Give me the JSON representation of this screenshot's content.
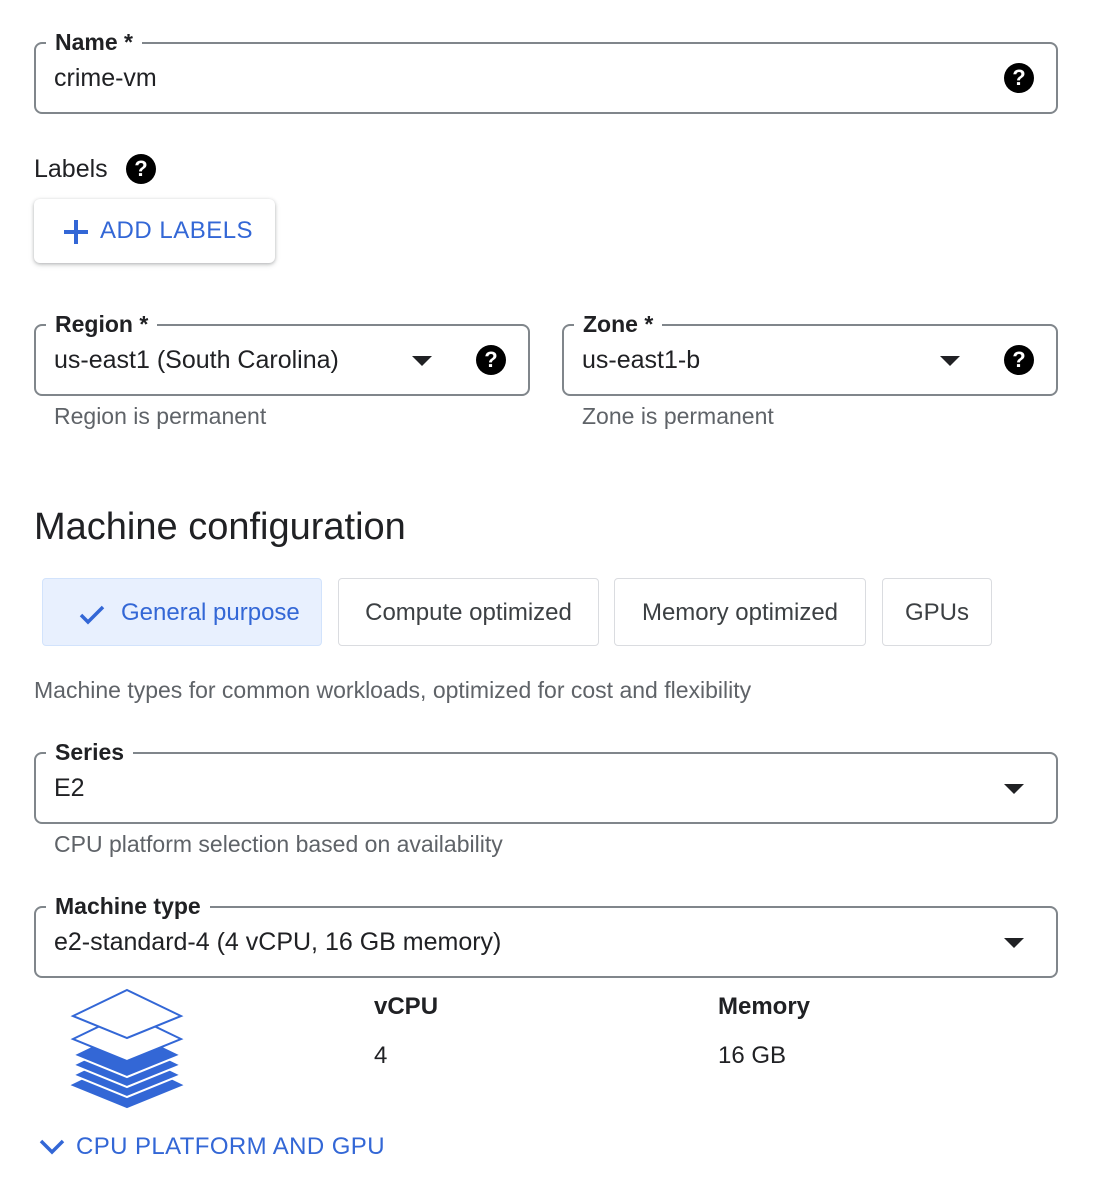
{
  "name_field": {
    "label": "Name *",
    "value": "crime-vm"
  },
  "labels": {
    "title": "Labels",
    "add_button": "ADD LABELS"
  },
  "region_field": {
    "label": "Region *",
    "value": "us-east1 (South Carolina)",
    "helper": "Region is permanent"
  },
  "zone_field": {
    "label": "Zone *",
    "value": "us-east1-b",
    "helper": "Zone is permanent"
  },
  "machine_config": {
    "title": "Machine configuration",
    "tabs": [
      {
        "label": "General purpose",
        "selected": true
      },
      {
        "label": "Compute optimized",
        "selected": false
      },
      {
        "label": "Memory optimized",
        "selected": false
      },
      {
        "label": "GPUs",
        "selected": false
      }
    ],
    "description": "Machine types for common workloads, optimized for cost and flexibility"
  },
  "series_field": {
    "label": "Series",
    "value": "E2",
    "helper": "CPU platform selection based on availability"
  },
  "machine_type_field": {
    "label": "Machine type",
    "value": "e2-standard-4 (4 vCPU, 16 GB memory)"
  },
  "specs": {
    "vcpu_label": "vCPU",
    "vcpu_value": "4",
    "memory_label": "Memory",
    "memory_value": "16 GB"
  },
  "expand_link": {
    "label": "CPU PLATFORM AND GPU"
  },
  "colors": {
    "accent": "#3367d6",
    "outline": "#80868b",
    "helper_text": "#5f6368"
  },
  "icons": [
    "help-icon",
    "plus-icon",
    "dropdown-arrow-icon",
    "check-icon",
    "stacked-layers-icon",
    "chevron-down-icon"
  ]
}
